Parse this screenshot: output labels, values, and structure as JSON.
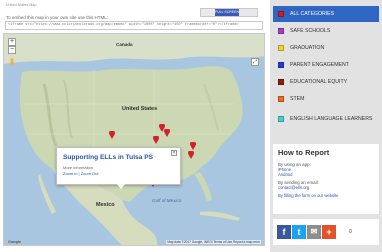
{
  "page": {
    "top_note": "United States Map",
    "fullscreen_label": "FULL SCREEN MAP",
    "embed_label": "To embed this map in your own site use this HTML:",
    "embed_code": "<iframe src=\"https://www.colorincolorado.org/map/embed\" width=\"100%\" height=\"450\" frameborder=\"0\"></iframe>"
  },
  "map": {
    "labels": {
      "country_us": "United States",
      "country_mx": "Mexico",
      "gulf": "Gulf of Mexico",
      "canada": "Canada"
    },
    "controls": {
      "zoom_in": "+",
      "zoom_out": "−",
      "expand": "⤢"
    },
    "popup": {
      "title": "Supporting ELLs in Tulsa PS",
      "info": "More information",
      "links": "Zoom in | Zoom Out",
      "close": "×"
    },
    "footer": {
      "logo": "Google",
      "attribution": "Map data ©2017 Google, INEGI   Terms of Use   Report a map error"
    },
    "pin_color": "#d6202a"
  },
  "sidebar": {
    "categories": [
      {
        "label": "ALL CATEGORIES",
        "color": "#c71f26",
        "active": true
      },
      {
        "label": "SAFE SCHOOLS",
        "color": "#a33ed0",
        "active": false
      },
      {
        "label": "GRADUATION",
        "color": "#f2d227",
        "active": false
      },
      {
        "label": "PARENT ENGAGEMENT",
        "color": "#1f3bd6",
        "active": false
      },
      {
        "label": "EDUCATIONAL EQUITY",
        "color": "#8a1e12",
        "active": false
      },
      {
        "label": "STEM",
        "color": "#ee6a24",
        "active": false
      },
      {
        "label": "ENGLISH LANGUAGE LEARNERS",
        "color": "#3fd3d0",
        "active": false
      }
    ],
    "report": {
      "title": "How to Report",
      "app_heading": "By using an app:",
      "app_links": [
        "iPhone",
        "Android"
      ],
      "email_heading": "By sending an email:",
      "email_link": "contact@ells.org",
      "form_link": "By filling the form on our website"
    },
    "share": {
      "facebook": "f",
      "twitter": "t",
      "email": "✉",
      "plus": "+",
      "count": "0",
      "colors": {
        "facebook": "#3b5998",
        "twitter": "#1da1f2",
        "email": "#8e8e8e",
        "plus": "#e0532b"
      }
    }
  }
}
